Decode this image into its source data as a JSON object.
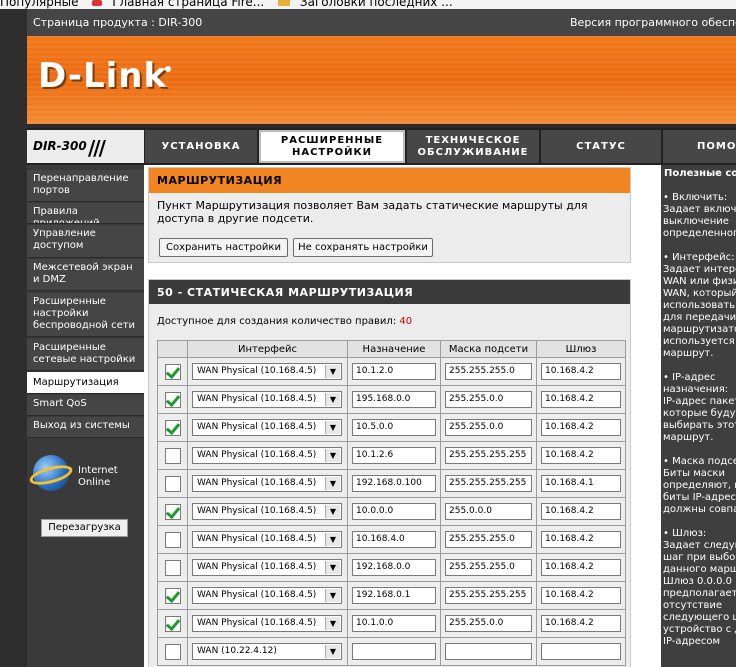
{
  "browser": {
    "bookmarks": [
      "Популярные",
      "Главная страница Fire...",
      "Заголовки последних ..."
    ]
  },
  "product": {
    "label": "Страница продукта :",
    "model": "DIR-300",
    "version_label": "Версия программного обеспечения"
  },
  "logo": {
    "text": "D-Link",
    "model_tag": "DIR-300",
    "slash": "///"
  },
  "nav": {
    "tabs": [
      {
        "l1": "УСТАНОВКА",
        "l2": ""
      },
      {
        "l1": "РАСШИРЕННЫЕ",
        "l2": "НАСТРОЙКИ"
      },
      {
        "l1": "ТЕХНИЧЕСКОЕ",
        "l2": "ОБСЛУЖИВАНИЕ"
      },
      {
        "l1": "СТАТУС",
        "l2": ""
      },
      {
        "l1": "ПОМОЩЬ",
        "l2": ""
      }
    ]
  },
  "sidebar": {
    "items": [
      "Перенаправление портов",
      "Правила приложений",
      "Управление доступом",
      "Межсетевой экран и DMZ",
      "Расширенные настройки беспроводной сети",
      "Расширенные сетевые настройки",
      "Маршрутизация",
      "Smart QoS",
      "Выход из системы"
    ],
    "internet_status_1": "Internet",
    "internet_status_2": "Online",
    "reboot": "Перезагрузка"
  },
  "routing": {
    "title": "МАРШРУТИЗАЦИЯ",
    "description": "Пункт Маршрутизация позволяет Вам задать статические маршруты для доступа в другие подсети.",
    "save_button": "Сохранить настройки",
    "cancel_button": "Не сохранять настройки"
  },
  "static": {
    "title": "50 - СТАТИЧЕСКАЯ МАРШРУТИЗАЦИЯ",
    "available_label": "Доступное для создания количество правил:",
    "available_count": "40",
    "headers": [
      "Интерфейс",
      "Назначение",
      "Маска подсети",
      "Шлюз"
    ],
    "rows": [
      {
        "checked": true,
        "iface": "WAN Physical (10.168.4.5)",
        "dest": "10.1.2.0",
        "mask": "255.255.255.0",
        "gw": "10.168.4.2"
      },
      {
        "checked": true,
        "iface": "WAN Physical (10.168.4.5)",
        "dest": "195.168.0.0",
        "mask": "255.255.0.0",
        "gw": "10.168.4.2"
      },
      {
        "checked": true,
        "iface": "WAN Physical (10.168.4.5)",
        "dest": "10.5.0.0",
        "mask": "255.255.0.0",
        "gw": "10.168.4.2"
      },
      {
        "checked": false,
        "iface": "WAN Physical (10.168.4.5)",
        "dest": "10.1.2.6",
        "mask": "255.255.255.255",
        "gw": "10.168.4.2"
      },
      {
        "checked": false,
        "iface": "WAN Physical (10.168.4.5)",
        "dest": "192.168.0.100",
        "mask": "255.255.255.255",
        "gw": "10.168.4.1"
      },
      {
        "checked": true,
        "iface": "WAN Physical (10.168.4.5)",
        "dest": "10.0.0.0",
        "mask": "255.0.0.0",
        "gw": "10.168.4.2"
      },
      {
        "checked": false,
        "iface": "WAN Physical (10.168.4.5)",
        "dest": "10.168.4.0",
        "mask": "255.255.255.0",
        "gw": "10.168.4.2"
      },
      {
        "checked": false,
        "iface": "WAN Physical (10.168.4.5)",
        "dest": "192.168.0.0",
        "mask": "255.255.255.0",
        "gw": "10.168.4.2"
      },
      {
        "checked": true,
        "iface": "WAN Physical (10.168.4.5)",
        "dest": "192.168.0.1",
        "mask": "255.255.255.255",
        "gw": "10.168.4.2"
      },
      {
        "checked": true,
        "iface": "WAN Physical (10.168.4.5)",
        "dest": "10.1.0.0",
        "mask": "255.255.0.0",
        "gw": "10.168.4.2"
      },
      {
        "checked": false,
        "iface": "WAN (10.22.4.12)",
        "dest": "",
        "mask": "",
        "gw": ""
      }
    ]
  },
  "help": {
    "title": "Полезные советы...",
    "lines": [
      "• Включить:",
      "Задает включение/",
      "выключение",
      "определенного",
      "",
      "• Интерфейс:",
      "Задает интерфейс",
      "WAN или физич",
      "WAN, который",
      "использовать",
      "для передачи",
      "маршрутизатор",
      "используется",
      "маршрут.",
      "",
      "• IP-адрес",
      "назначения:",
      "IP-адрес пакет",
      "которые будут",
      "выбирать этот",
      "маршрут.",
      "",
      "• Маска подсети",
      "Биты маски",
      "определяют, к",
      "биты IP-адрес",
      "должны совпа",
      "",
      "• Шлюз:",
      "Задает следую",
      "шаг при выбор",
      "данного марш",
      "Шлюз 0.0.0.0",
      "предполагает",
      "отсутствие",
      "следующего ш",
      "устройство с д",
      "IP-адресом"
    ]
  }
}
